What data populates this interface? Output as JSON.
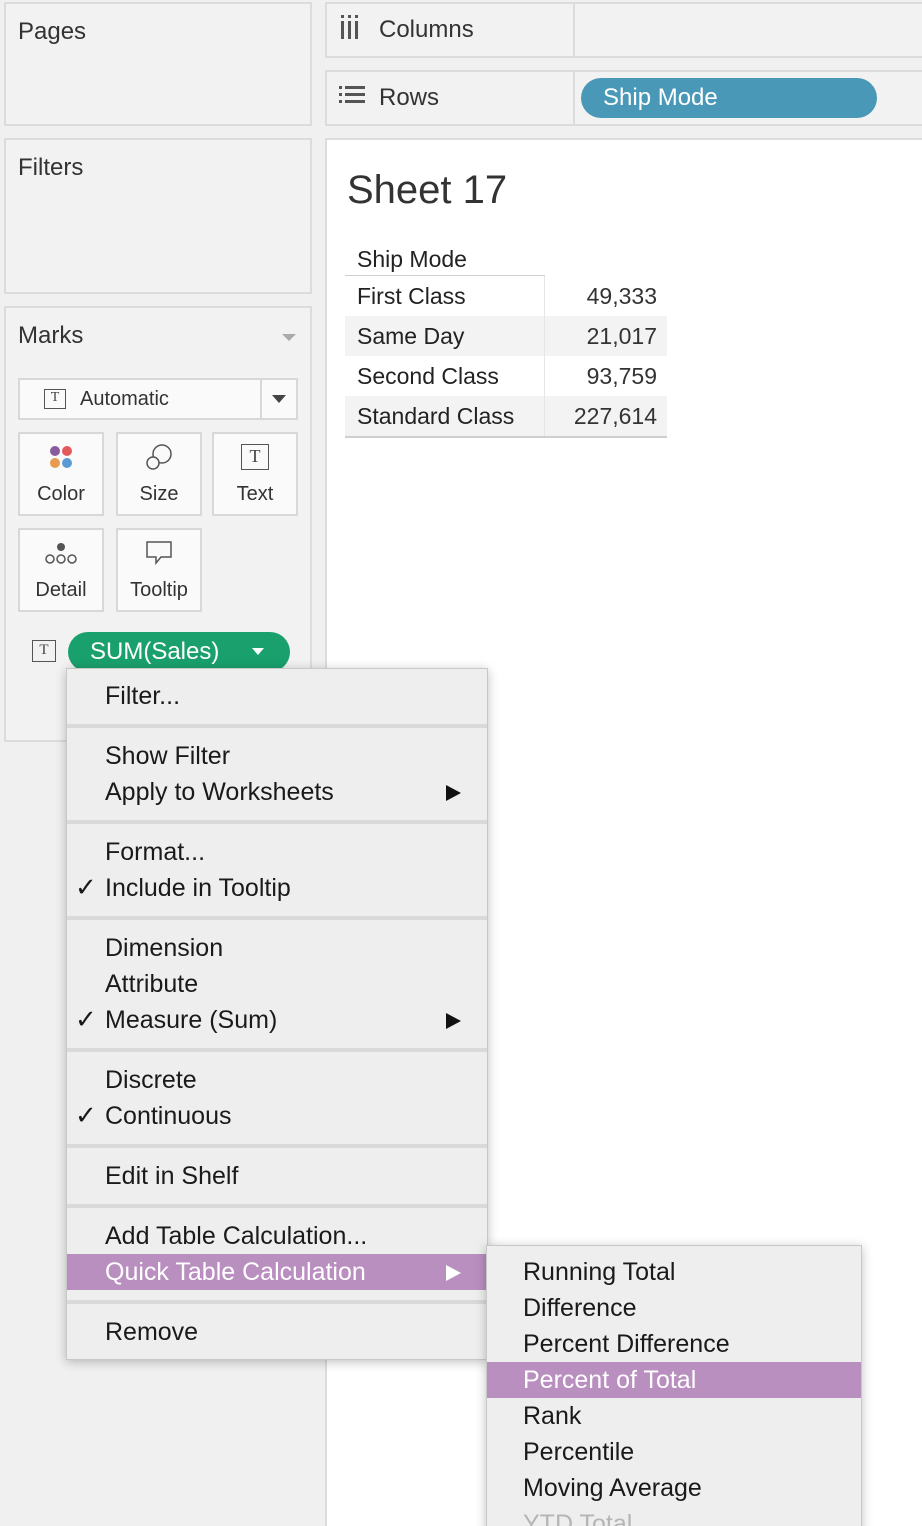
{
  "left_panel": {
    "pages_title": "Pages",
    "filters_title": "Filters",
    "marks_title": "Marks",
    "mark_type": "Automatic",
    "mark_buttons": [
      {
        "label": "Color",
        "icon": "color-dots-icon"
      },
      {
        "label": "Size",
        "icon": "size-icon"
      },
      {
        "label": "Text",
        "icon": "text-t-icon"
      },
      {
        "label": "Detail",
        "icon": "detail-dots-icon"
      },
      {
        "label": "Tooltip",
        "icon": "tooltip-speech-icon"
      }
    ],
    "marks_pill": "SUM(Sales)"
  },
  "shelves": {
    "columns_label": "Columns",
    "rows_label": "Rows",
    "rows_pill": "Ship Mode"
  },
  "colors": {
    "dimension_pill": "#4a98b8",
    "measure_pill": "#19a06c",
    "menu_highlight": "#b98fbf"
  },
  "sheet": {
    "title": "Sheet 17",
    "table": {
      "header": "Ship Mode",
      "rows": [
        {
          "category": "First Class",
          "value": "49,333"
        },
        {
          "category": "Same Day",
          "value": "21,017"
        },
        {
          "category": "Second Class",
          "value": "93,759"
        },
        {
          "category": "Standard Class",
          "value": "227,614"
        }
      ]
    }
  },
  "context_menu": {
    "filter": "Filter...",
    "show_filter": "Show Filter",
    "apply_to_worksheets": "Apply to Worksheets",
    "format": "Format...",
    "include_in_tooltip": "Include in Tooltip",
    "dimension": "Dimension",
    "attribute": "Attribute",
    "measure_sum": "Measure (Sum)",
    "discrete": "Discrete",
    "continuous": "Continuous",
    "edit_in_shelf": "Edit in Shelf",
    "add_table_calculation": "Add Table Calculation...",
    "quick_table_calculation": "Quick Table Calculation",
    "remove": "Remove",
    "check_mark": "✓"
  },
  "submenu": {
    "items": [
      "Running Total",
      "Difference",
      "Percent Difference",
      "Percent of Total",
      "Rank",
      "Percentile",
      "Moving Average",
      "YTD Total"
    ],
    "highlighted": "Percent of Total"
  }
}
